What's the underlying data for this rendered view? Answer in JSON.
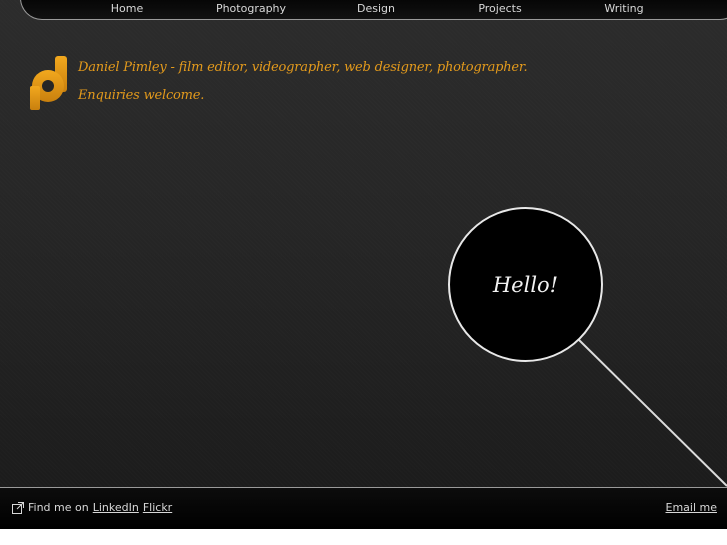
{
  "nav": {
    "items": [
      {
        "label": "Home"
      },
      {
        "label": "Photography"
      },
      {
        "label": "Design"
      },
      {
        "label": "Projects"
      },
      {
        "label": "Writing"
      }
    ]
  },
  "header": {
    "logo_icon": "pd-logo-icon",
    "tagline": "Daniel Pimley - film editor, videographer, web designer, photographer.",
    "subtagline": "Enquiries welcome."
  },
  "bubble": {
    "text": "Hello!"
  },
  "footer": {
    "find_me_text": "Find me on",
    "link_linkedin": "LinkedIn",
    "link_flickr": "Flickr",
    "email_link": "Email me",
    "external_icon": "external-link-icon"
  },
  "colors": {
    "accent": "#e39a1c",
    "text_light": "#d8d8d8",
    "background": "#262626"
  }
}
